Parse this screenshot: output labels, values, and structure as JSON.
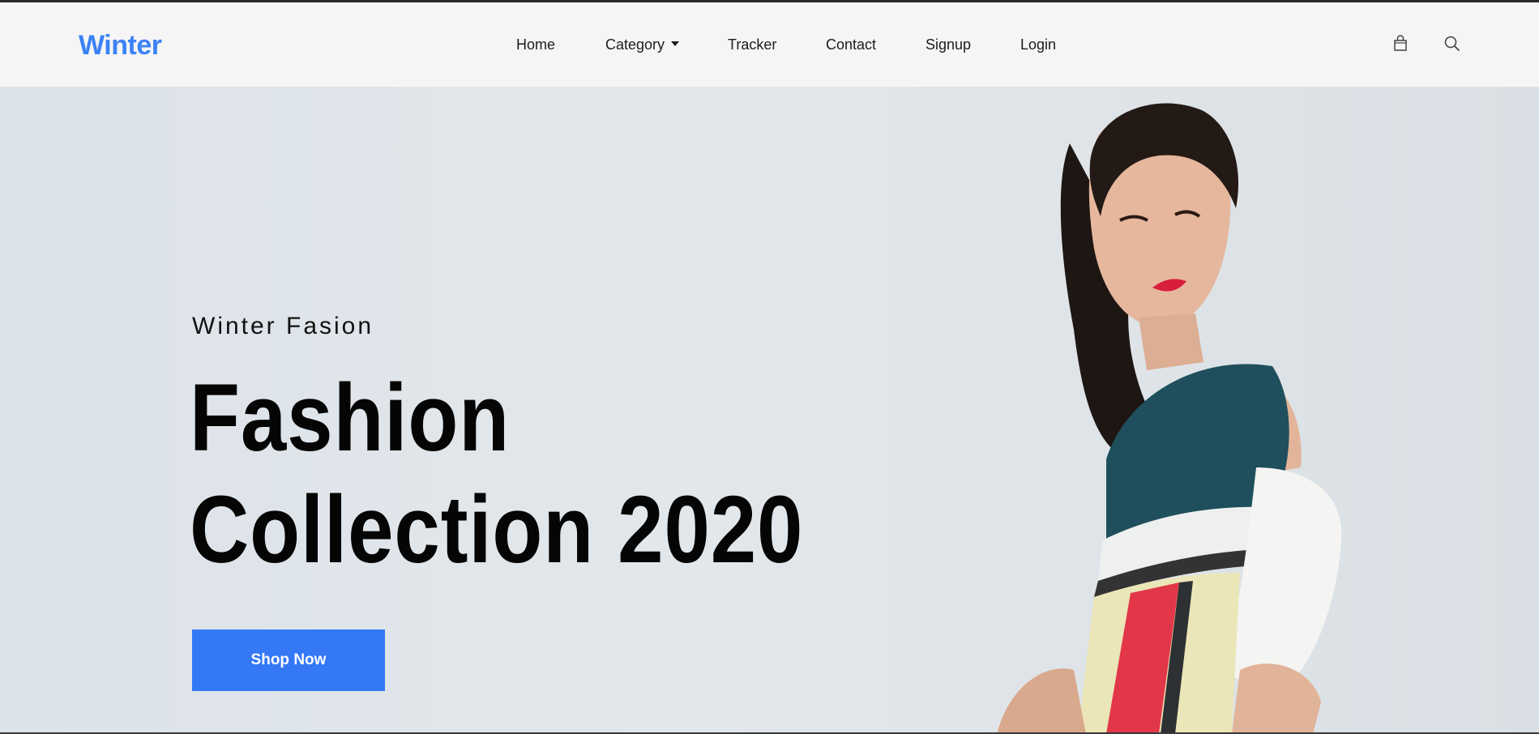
{
  "brand": {
    "logo": "Winter",
    "accent_color": "#3b82f6"
  },
  "nav": {
    "items": [
      {
        "label": "Home"
      },
      {
        "label": "Category",
        "has_dropdown": true
      },
      {
        "label": "Tracker"
      },
      {
        "label": "Contact"
      },
      {
        "label": "Signup"
      },
      {
        "label": "Login"
      }
    ]
  },
  "header_icons": {
    "cart": "shopping-bag-icon",
    "search": "search-icon"
  },
  "hero": {
    "subtitle": "Winter Fasion",
    "title_line1": "Fashion",
    "title_line2": "Collection 2020",
    "cta_label": "Shop Now",
    "cta_color": "#3478f6",
    "image": "fashion-model-photo"
  }
}
